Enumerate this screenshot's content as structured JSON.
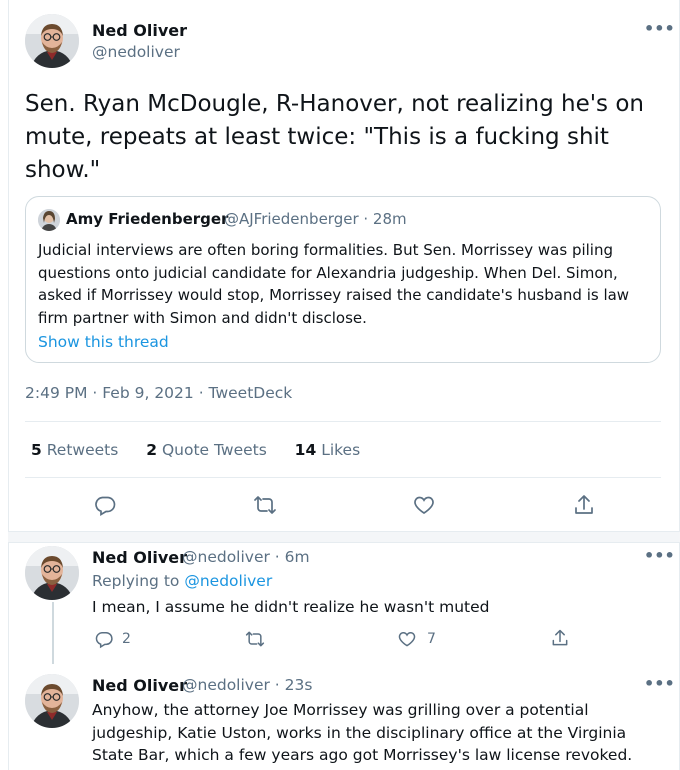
{
  "main_tweet": {
    "author_name": "Ned Oliver",
    "author_handle": "@nedoliver",
    "text": "Sen. Ryan McDougle, R-Hanover, not realizing he's on mute, repeats at least twice: \"This is a fucking shit show.\"",
    "quoted": {
      "author_name": "Amy Friedenberger",
      "author_handle": "@AJFriedenberger · 28m",
      "text": "Judicial interviews are often boring formalities. But Sen. Morrissey was piling questions onto judicial candidate for Alexandria judgeship. When Del. Simon, asked if Morrissey would stop, Morrissey raised the candidate's husband is law firm partner with Simon and didn't disclose.",
      "show_thread": "Show this thread"
    },
    "timestamp": "2:49 PM · Feb 9, 2021 · TweetDeck",
    "stats": {
      "retweets_count": "5",
      "retweets_label": "Retweets",
      "quotes_count": "2",
      "quotes_label": "Quote Tweets",
      "likes_count": "14",
      "likes_label": "Likes"
    }
  },
  "replies": [
    {
      "author_name": "Ned Oliver",
      "meta": "@nedoliver · 6m",
      "replying_prefix": "Replying to",
      "replying_to": "@nedoliver",
      "text": "I mean, I assume he didn't realize he wasn't muted",
      "reply_count": "2",
      "like_count": "7"
    },
    {
      "author_name": "Ned Oliver",
      "meta": "@nedoliver · 23s",
      "text": "Anyhow, the attorney Joe Morrissey was grilling over a potential judgeship, Katie Uston, works in the disciplinary office at the Virginia State Bar, which a few years ago got Morrissey's law license revoked."
    }
  ],
  "icons": {
    "more": "more-icon",
    "reply": "reply-icon",
    "retweet": "retweet-icon",
    "like": "heart-icon",
    "share": "share-icon"
  },
  "colors": {
    "accent": "#1b95e0",
    "muted": "#5b7083",
    "border": "#e6ecf0"
  }
}
